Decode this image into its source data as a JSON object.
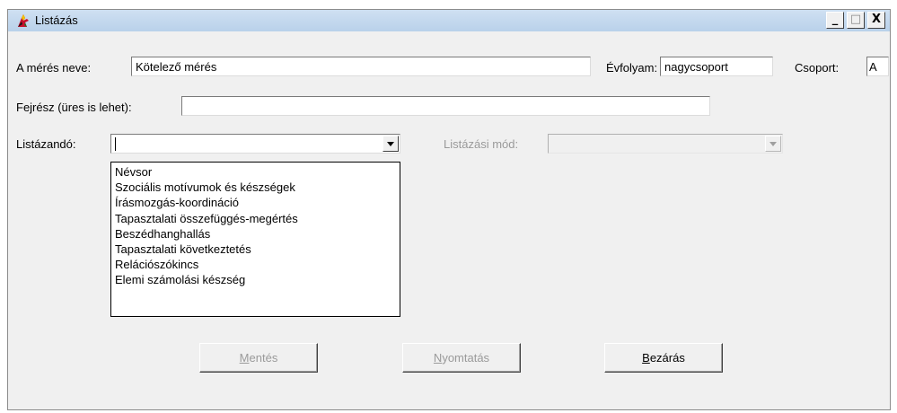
{
  "window": {
    "title": "Listázás",
    "controls": {
      "minimize": "_",
      "maximize": "□",
      "close": "X"
    }
  },
  "form": {
    "name_label": "A mérés neve:",
    "name_value": "Kötelező mérés",
    "grade_label": "Évfolyam:",
    "grade_value": "nagycsoport",
    "group_label": "Csoport:",
    "group_value": "A",
    "header_label": "Fejrész (üres is lehet):",
    "header_value": "",
    "list_label": "Listázandó:",
    "list_value": "",
    "mode_label": "Listázási mód:",
    "mode_value": ""
  },
  "dropdown_options": [
    "Névsor",
    "Szociális motívumok és készségek",
    "Írásmozgás-koordináció",
    "Tapasztalati összefüggés-megértés",
    "Beszédhanghallás",
    "Tapasztalati következtetés",
    "Relációszókincs",
    "Elemi számolási készség"
  ],
  "buttons": {
    "save": {
      "key": "M",
      "rest": "entés",
      "enabled": false
    },
    "print": {
      "key": "N",
      "rest": "yomtatás",
      "enabled": false
    },
    "close": {
      "key": "B",
      "rest": "ezárás",
      "enabled": true
    }
  },
  "colors": {
    "window_bg": "#f0f0f0",
    "titlebar": "#b9d1ea",
    "disabled_text": "#9a9a9a"
  }
}
